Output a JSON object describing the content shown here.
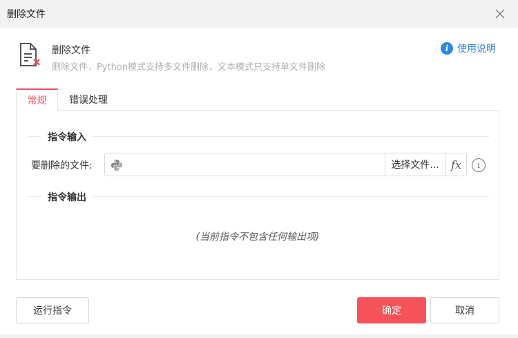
{
  "dialog": {
    "title": "删除文件"
  },
  "header": {
    "name": "删除文件",
    "description": "删除文件，Python模式支持多文件删除，文本模式只支持单文件删除",
    "help_label": "使用说明"
  },
  "tabs": [
    {
      "label": "常规",
      "active": true
    },
    {
      "label": "错误处理",
      "active": false
    }
  ],
  "input_section": {
    "title": "指令输入",
    "field_label": "要删除的文件:",
    "field_value": "",
    "choose_label": "选择文件...",
    "fx_label": "fx"
  },
  "output_section": {
    "title": "指令输出",
    "empty_text": "(当前指令不包含任何输出项)"
  },
  "footer": {
    "run_label": "运行指令",
    "ok_label": "确定",
    "cancel_label": "取消"
  },
  "colors": {
    "accent": "#f5525a",
    "link": "#2f86e0",
    "icon_red": "#e8505b"
  },
  "icons": {
    "close": "close-icon",
    "file_delete": "file-delete-icon",
    "help": "info-circle-icon",
    "python": "python-icon",
    "info": "info-outline-icon"
  }
}
